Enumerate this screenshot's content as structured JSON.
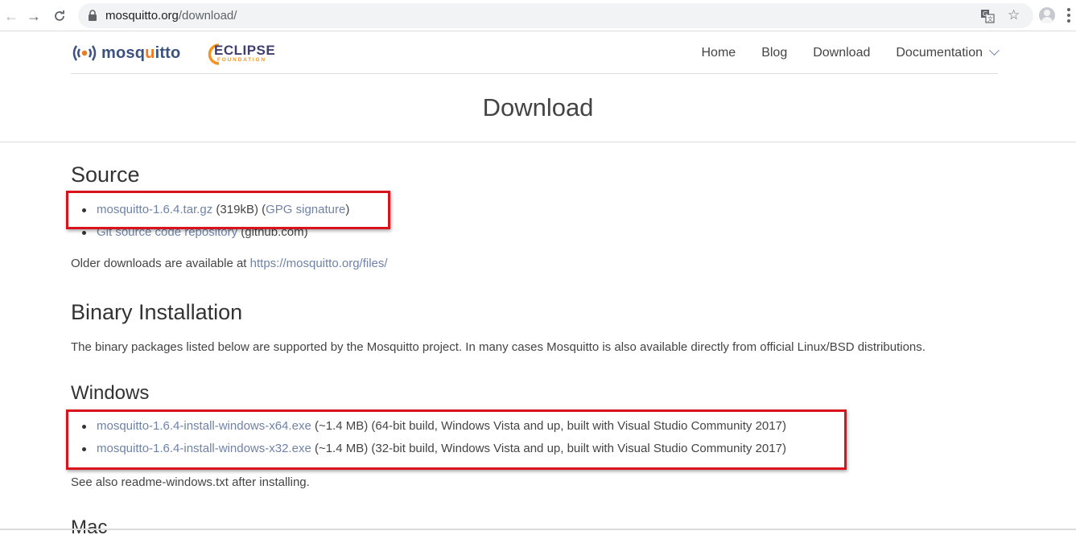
{
  "browser": {
    "url_host": "mosquitto.org",
    "url_path": "/download/",
    "icons": [
      "back-arrow-icon",
      "forward-arrow-icon",
      "reload-icon",
      "lock-icon",
      "translate-icon",
      "star-icon",
      "profile-icon",
      "menu-icon"
    ]
  },
  "header": {
    "logo_main": "mosq",
    "logo_accent": "u",
    "logo_rest": "itto",
    "eclipse_word": "ECLIPSE",
    "foundation_word": "FOUNDATION",
    "nav": {
      "home": "Home",
      "blog": "Blog",
      "download": "Download",
      "documentation": "Documentation"
    }
  },
  "page": {
    "title": "Download"
  },
  "source": {
    "heading": "Source",
    "items": [
      {
        "link": "mosquitto-1.6.4.tar.gz",
        "after_link": " (319kB) (",
        "link2": "GPG signature",
        "tail": ")"
      },
      {
        "link": "Git source code repository",
        "tail": " (github.com)"
      }
    ],
    "older_text": "Older downloads are available at ",
    "older_link": "https://mosquitto.org/files/"
  },
  "binary": {
    "heading": "Binary Installation",
    "text": "The binary packages listed below are supported by the Mosquitto project. In many cases Mosquitto is also available directly from official Linux/BSD distributions."
  },
  "windows": {
    "heading": "Windows",
    "items": [
      {
        "link": "mosquitto-1.6.4-install-windows-x64.exe",
        "tail": " (~1.4 MB) (64-bit build, Windows Vista and up, built with Visual Studio Community 2017)"
      },
      {
        "link": "mosquitto-1.6.4-install-windows-x32.exe",
        "tail": " (~1.4 MB) (32-bit build, Windows Vista and up, built with Visual Studio Community 2017)"
      }
    ],
    "readme": "See also readme-windows.txt after installing."
  },
  "mac": {
    "heading": "Mac"
  },
  "colors": {
    "link": "#6f82a8",
    "highlight": "#d9121b",
    "logo_blue": "#3c5280",
    "logo_orange": "#f07a1e"
  }
}
